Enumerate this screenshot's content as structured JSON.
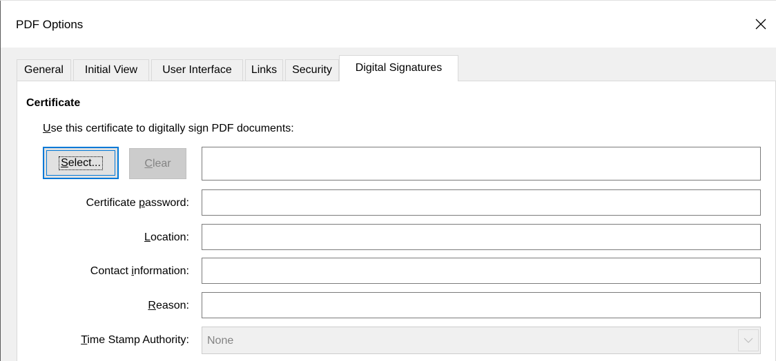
{
  "window": {
    "title": "PDF Options",
    "close_icon": "close-icon"
  },
  "tabs": [
    {
      "label": "General",
      "active": false
    },
    {
      "label": "Initial View",
      "active": false
    },
    {
      "label": "User Interface",
      "active": false
    },
    {
      "label": "Links",
      "active": false
    },
    {
      "label": "Security",
      "active": false
    },
    {
      "label": "Digital Signatures",
      "active": true
    }
  ],
  "certificate": {
    "section_title": "Certificate",
    "use_label_mnemonic": "U",
    "use_label_rest": "se this certificate to digitally sign PDF documents:",
    "select_button_mnemonic": "S",
    "select_button_rest": "elect...",
    "clear_button_mnemonic": "C",
    "clear_button_rest": "lear",
    "clear_enabled": false,
    "certificate_value": ""
  },
  "fields": {
    "password_label_pre": "Certificate ",
    "password_label_mnemonic": "p",
    "password_label_post": "assword:",
    "password_value": "",
    "location_label_mnemonic": "L",
    "location_label_post": "ocation:",
    "location_value": "",
    "contact_label_pre": "Contact ",
    "contact_label_mnemonic": "i",
    "contact_label_post": "nformation:",
    "contact_value": "",
    "reason_label_mnemonic": "R",
    "reason_label_post": "eason:",
    "reason_value": "",
    "tsa_label_mnemonic": "T",
    "tsa_label_post": "ime Stamp Authority:",
    "tsa_value": "None",
    "tsa_enabled": false
  },
  "colors": {
    "focus_accent": "#0078d7",
    "disabled_text": "#838383"
  }
}
